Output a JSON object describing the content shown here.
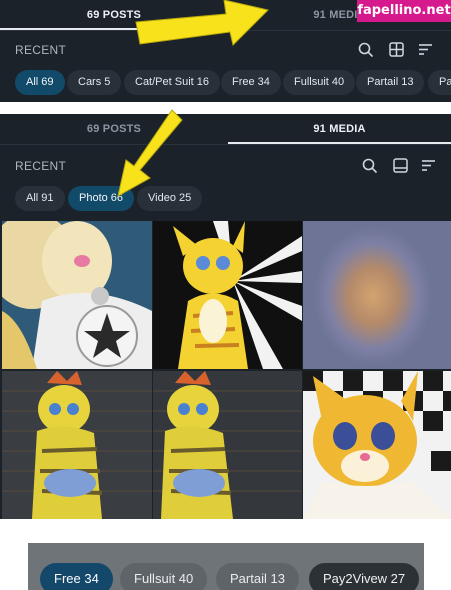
{
  "panel1": {
    "tabs": [
      "69 POSTS",
      "91 MEDIA"
    ],
    "recent_label": "RECENT",
    "filters": [
      "All 69",
      "Cars 5",
      "Cat/Pet Suit 16",
      "Free 34",
      "Fullsuit 40",
      "Partail 13",
      "Pa"
    ]
  },
  "watermark": "fapellino.net",
  "panel2": {
    "tabs": [
      "69 POSTS",
      "91 MEDIA"
    ],
    "recent_label": "RECENT",
    "filters": [
      "All 91",
      "Photo 66",
      "Video 25"
    ]
  },
  "strip": {
    "filters": [
      "Free 34",
      "Fullsuit 40",
      "Partail 13",
      "Pay2Vivew 27"
    ]
  },
  "media": [
    {
      "name": "thumb-1"
    },
    {
      "name": "thumb-2"
    },
    {
      "name": "thumb-3"
    },
    {
      "name": "thumb-4"
    },
    {
      "name": "thumb-5"
    },
    {
      "name": "thumb-6"
    }
  ],
  "colors": {
    "accent": "#124a6a",
    "panel": "#1c222a",
    "arrow": "#f7e21b",
    "watermark": "#d6198c"
  },
  "icons": [
    "search-icon",
    "grid-icon",
    "sort-icon",
    "layout-icon",
    "arrow-annotation"
  ]
}
